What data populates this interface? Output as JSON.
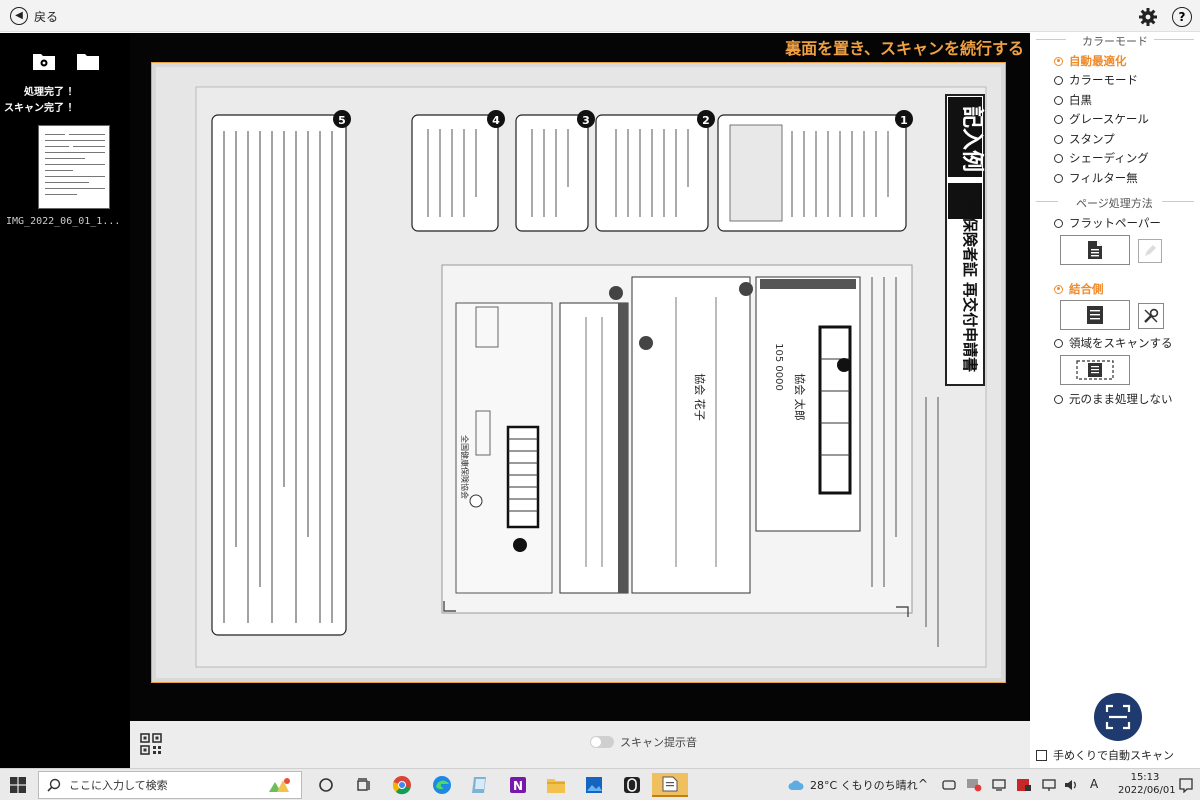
{
  "topbar": {
    "back_label": "戻る",
    "settings_icon": "gear-icon",
    "help_icon": "help-icon",
    "help_glyph": "?"
  },
  "left_panel": {
    "status_done": "処理完了 ！",
    "status_scan": "スキャン完了 ！",
    "thumbnail_name": "IMG_2022_06_01_1..."
  },
  "viewer": {
    "hint": "裏面を置き、スキャンを続行する"
  },
  "document": {
    "title": "記入例",
    "form_title": "被保険者証 再交付申請書",
    "header_label": "健康保険",
    "boxes": [
      {
        "num": "1",
        "text": "記号番号は、保険証に記載されています。また、協会けんぽ都道府県支部からお送りしております各種通知等でもご確認いただけます。"
      },
      {
        "num": "2",
        "text": "再交付が必要な方の保険者を本人か被扶養者かを選んで、ご記入ください。"
      },
      {
        "num": "3",
        "text": "再交付の理由が「滅失」や「その他」の場合は詳細な理由をご記入ください。"
      },
      {
        "num": "4",
        "text": "事業所に勤務している被保険者の方が再交付を申請する場合は、事業主の証明が必要です。"
      },
      {
        "num": "5",
        "text": "被保険者の記号番号が不明な場合のみ被保険者のマイナンバーを記入してください。"
      }
    ],
    "sample_name": "協会 太郎",
    "sample_dependent": "協会 花子",
    "sample_zip": "105 0000",
    "org_name": "全国健康保険協会"
  },
  "scan_strip": {
    "sound_label": "スキャン提示音",
    "qr_icon": "qr-code-icon"
  },
  "right_panel": {
    "color_mode_title": "カラーモード",
    "color_modes": [
      {
        "label": "自動最適化",
        "selected": true
      },
      {
        "label": "カラーモード",
        "selected": false
      },
      {
        "label": "白黒",
        "selected": false
      },
      {
        "label": "グレースケール",
        "selected": false
      },
      {
        "label": "スタンプ",
        "selected": false
      },
      {
        "label": "シェーディング",
        "selected": false
      },
      {
        "label": "フィルター無",
        "selected": false
      }
    ],
    "page_method_title": "ページ処理方法",
    "page_methods": [
      {
        "label": "フラットペーパー",
        "selected": false
      },
      {
        "label": "結合側",
        "selected": true
      },
      {
        "label": "領域をスキャンする",
        "selected": false
      },
      {
        "label": "元のまま処理しない",
        "selected": false
      }
    ],
    "auto_scan_label": "手めくりで自動スキャン",
    "accent": "#f08a2a"
  },
  "taskbar": {
    "search_placeholder": "ここに入力して検索",
    "weather": "28°C くもりのち晴れ",
    "ime": "A",
    "time": "15:13",
    "date": "2022/06/01"
  }
}
